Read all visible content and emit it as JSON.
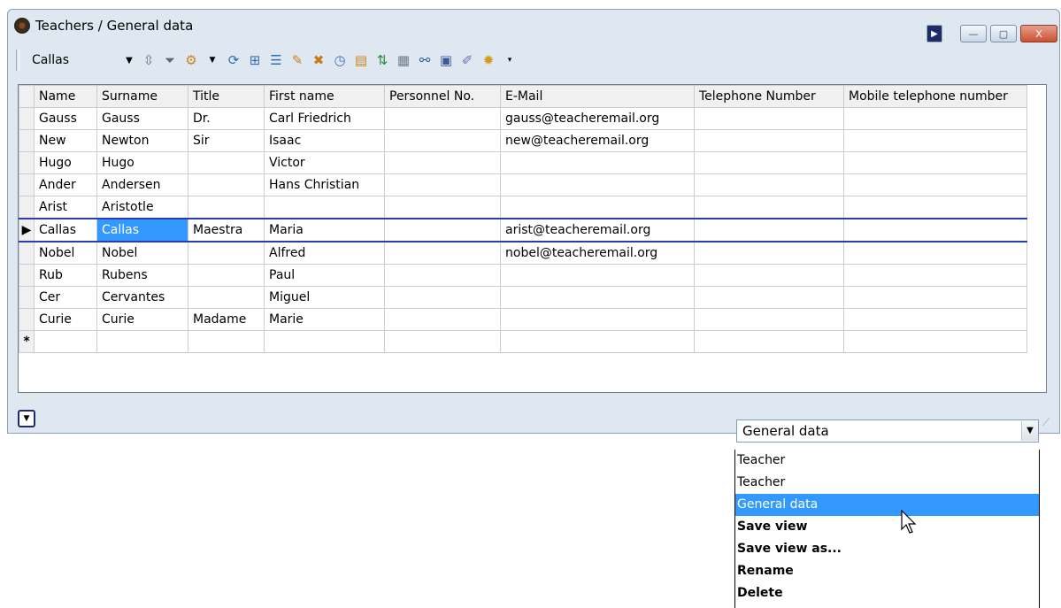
{
  "window": {
    "title": "Teachers / General data",
    "close_label": "X",
    "minimize_label": "—",
    "maximize_label": "▢"
  },
  "toolbar": {
    "combo_value": "Callas",
    "icons": [
      "updown-icon",
      "filter-icon",
      "settings-icon",
      "refresh-icon",
      "grid-icon",
      "list-icon",
      "new-icon",
      "delete-icon",
      "clock-icon",
      "report-icon",
      "sort-icon",
      "table-icon",
      "link-icon",
      "calendar-icon",
      "tools-icon",
      "gear-icon"
    ]
  },
  "grid": {
    "columns": [
      "Name",
      "Surname",
      "Title",
      "First name",
      "Personnel No.",
      "E-Mail",
      "Telephone Number",
      "Mobile telephone number"
    ],
    "rows": [
      [
        "Gauss",
        "Gauss",
        "Dr.",
        "Carl Friedrich",
        "",
        "gauss@teacheremail.org",
        "",
        ""
      ],
      [
        "New",
        "Newton",
        "Sir",
        "Isaac",
        "",
        "new@teacheremail.org",
        "",
        ""
      ],
      [
        "Hugo",
        "Hugo",
        "",
        "Victor",
        "",
        "",
        "",
        ""
      ],
      [
        "Ander",
        "Andersen",
        "",
        "Hans Christian",
        "",
        "",
        "",
        ""
      ],
      [
        "Arist",
        "Aristotle",
        "",
        "",
        "",
        "",
        "",
        ""
      ],
      [
        "Callas",
        "Callas",
        "Maestra",
        "Maria",
        "",
        "arist@teacheremail.org",
        "",
        ""
      ],
      [
        "Nobel",
        "Nobel",
        "",
        "Alfred",
        "",
        "nobel@teacheremail.org",
        "",
        ""
      ],
      [
        "Rub",
        "Rubens",
        "",
        "Paul",
        "",
        "",
        "",
        ""
      ],
      [
        "Cer",
        "Cervantes",
        "",
        "Miguel",
        "",
        "",
        "",
        ""
      ],
      [
        "Curie",
        "Curie",
        "Madame",
        "Marie",
        "",
        "",
        "",
        ""
      ]
    ],
    "selected_row": 5,
    "new_row_marker": "*",
    "current_row_marker": "▶"
  },
  "view_selector": {
    "value": "General data",
    "options": [
      {
        "label": "Teacher",
        "bold": false,
        "highlighted": false
      },
      {
        "label": "Teacher",
        "bold": false,
        "highlighted": false
      },
      {
        "label": "General data",
        "bold": false,
        "highlighted": true
      },
      {
        "label": "Save view",
        "bold": true,
        "highlighted": false
      },
      {
        "label": "Save view as...",
        "bold": true,
        "highlighted": false
      },
      {
        "label": "Rename",
        "bold": true,
        "highlighted": false
      },
      {
        "label": "Delete",
        "bold": true,
        "highlighted": false
      }
    ]
  },
  "colors": {
    "selection": "#3399ff",
    "border_highlight": "#2b3bb8",
    "window_bg": "#dfe8f1"
  }
}
